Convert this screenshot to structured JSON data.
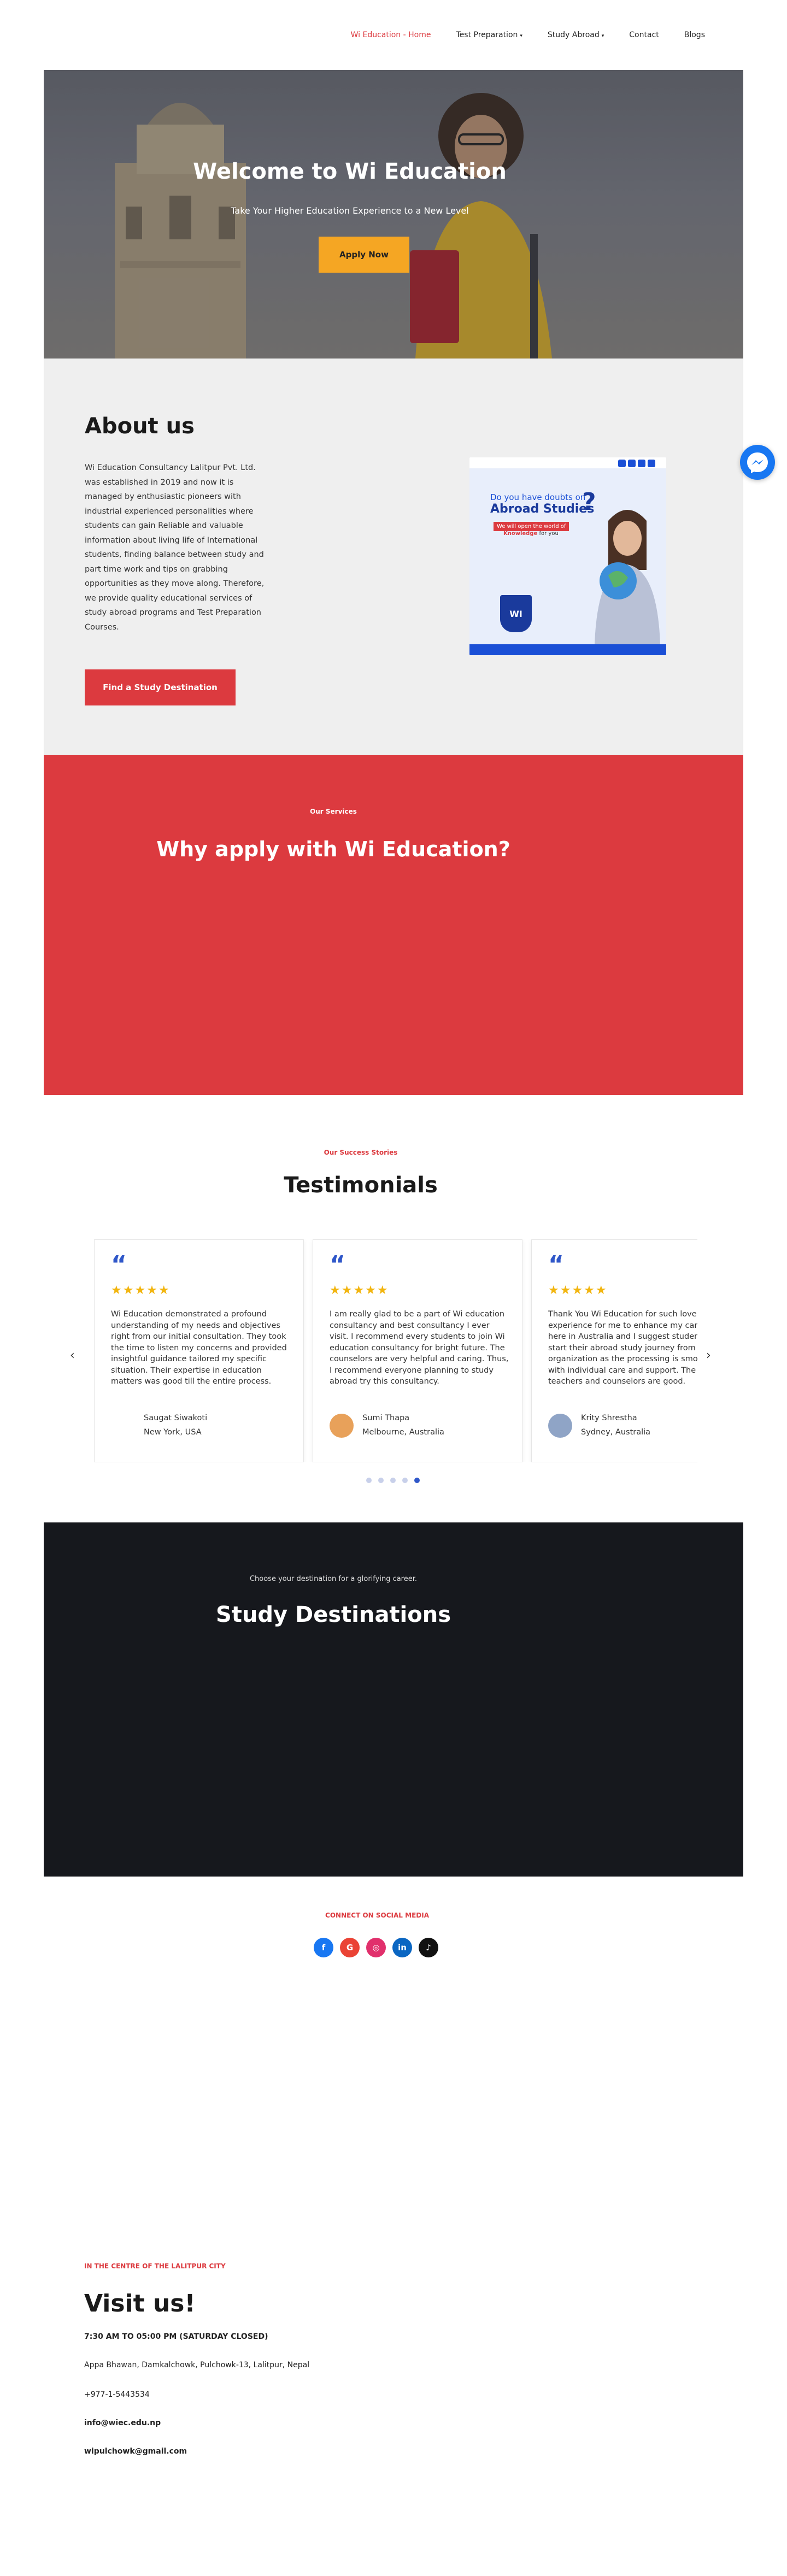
{
  "nav": {
    "items": [
      {
        "label": "Wi Education - Home",
        "active": true,
        "dropdown": false
      },
      {
        "label": "Test Preparation",
        "active": false,
        "dropdown": true
      },
      {
        "label": "Study Abroad",
        "active": false,
        "dropdown": true
      },
      {
        "label": "Contact",
        "active": false,
        "dropdown": false
      },
      {
        "label": "Blogs",
        "active": false,
        "dropdown": false
      }
    ]
  },
  "hero": {
    "title": "Welcome to Wi Education",
    "subtitle": "Take Your Higher Education Experience to a New Level",
    "button": "Apply Now"
  },
  "about": {
    "title": "About us",
    "body": "Wi Education Consultancy Lalitpur Pvt. Ltd. was established in 2019 and now it is managed by enthusiastic pioneers with industrial experienced personalities where students can gain Reliable and valuable information about living life of International students, finding balance between study and part time work and tips on grabbing opportunities as they move along. Therefore, we provide quality educational services of study abroad programs and Test Preparation Courses.",
    "button": "Find a Study Destination",
    "card": {
      "line1": "Do you have doubts on",
      "line2": "Abroad Studies",
      "qmark": "?",
      "tag": "We will open the world of",
      "tag2_a": "Knowledge",
      "tag2_b": " for you",
      "logo": "WI"
    }
  },
  "services": {
    "eyebrow": "Our Services",
    "title": "Why apply with Wi Education?"
  },
  "testimonials": {
    "eyebrow": "Our Success Stories",
    "title": "Testimonials",
    "quote_mark": "“",
    "prev_arrow": "‹",
    "next_arrow": "›",
    "active_dot": 4,
    "dot_count": 5,
    "items": [
      {
        "stars": "★★★★★",
        "text": "Wi Education demonstrated a profound understanding of my needs and objectives right from our initial consultation. They took the time to listen my concerns and provided insightful guidance tailored my specific situation. Their expertise in education matters was good till the entire process.",
        "name": "Saugat Siwakoti",
        "location": "New York, USA"
      },
      {
        "stars": "★★★★★",
        "text": "I am really glad to be a part of Wi education consultancy and best consultancy I ever visit. I recommend every students to join Wi education consultancy for bright future. The counselors are very helpful and caring. Thus, I recommend everyone planning to study abroad try this consultancy.",
        "name": "Sumi Thapa",
        "location": "Melbourne, Australia"
      },
      {
        "stars": "★★★★★",
        "text": "Thank You Wi Education for such lovely experience for me to enhance my career here in Australia and I suggest students to start their abroad study journey from this organization as the processing is smooth with individual care and support. The teachers and counselors are good.",
        "name": "Krity Shrestha",
        "location": "Sydney, Australia"
      }
    ]
  },
  "destinations": {
    "eyebrow": "Choose your destination for a glorifying career.",
    "title": "Study Destinations"
  },
  "social": {
    "eyebrow": "CONNECT ON SOCIAL MEDIA",
    "icons": [
      {
        "name": "facebook-icon",
        "glyph": "f",
        "color": "#1877f2"
      },
      {
        "name": "google-icon",
        "glyph": "G",
        "color": "#ea4335"
      },
      {
        "name": "instagram-icon",
        "glyph": "◎",
        "color": "#e1306c"
      },
      {
        "name": "linkedin-icon",
        "glyph": "in",
        "color": "#0a66c2"
      },
      {
        "name": "tiktok-icon",
        "glyph": "♪",
        "color": "#111111"
      }
    ]
  },
  "visit": {
    "eyebrow": "IN THE CENTRE OF THE LALITPUR CITY",
    "title": "Visit us!",
    "hours": "7:30 AM TO 05:00 PM (SATURDAY CLOSED)",
    "address": "Appa Bhawan, Damkalchowk, Pulchowk-13, Lalitpur, Nepal",
    "phone": "+977-1-5443534",
    "email1": "info@wiec.edu.np",
    "email2": "wipulchowk@gmail.com"
  }
}
